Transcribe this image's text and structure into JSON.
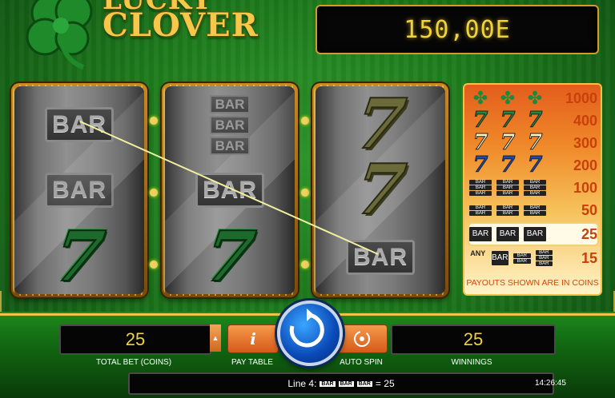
{
  "game": {
    "title_line1": "Lucky",
    "title_line2": "Clover",
    "balance": "150,00E"
  },
  "reels": [
    {
      "symbols": [
        "BAR",
        "BAR",
        "seven-green"
      ]
    },
    {
      "symbols": [
        "BAR BAR BAR",
        "BAR",
        "seven-green"
      ]
    },
    {
      "symbols": [
        "seven-olive",
        "seven-olive",
        "BAR"
      ]
    }
  ],
  "bar_label": "BAR",
  "seven_glyph": "7",
  "paytable": {
    "rows": [
      {
        "symbols": "clover x3",
        "payout": "1000"
      },
      {
        "symbols": "green 7 x3",
        "payout": "400"
      },
      {
        "symbols": "cream 7 x3",
        "payout": "300"
      },
      {
        "symbols": "blue 7 x3",
        "payout": "200"
      },
      {
        "symbols": "triple bar x3",
        "payout": "100"
      },
      {
        "symbols": "double bar x3",
        "payout": "50"
      },
      {
        "symbols": "single bar x3",
        "payout": "25"
      },
      {
        "symbols": "any bar",
        "payout": "15"
      }
    ],
    "any_label": "ANY",
    "footer": "PAYOUTS SHOWN ARE IN COINS"
  },
  "controls": {
    "total_bet_value": "25",
    "total_bet_label": "TOTAL BET (COINS)",
    "paytable_label": "PAY TABLE",
    "paytable_icon": "i",
    "auto_spin_label": "AUTO SPIN",
    "winnings_value": "25",
    "winnings_label": "WINNINGS"
  },
  "status": {
    "prefix": "Line 4:",
    "suffix": "= 25"
  },
  "clock": "14:26:45",
  "colors": {
    "accent": "#f3c24a",
    "display_text": "#f0d23a",
    "spin_button": "#0a4ab8"
  }
}
